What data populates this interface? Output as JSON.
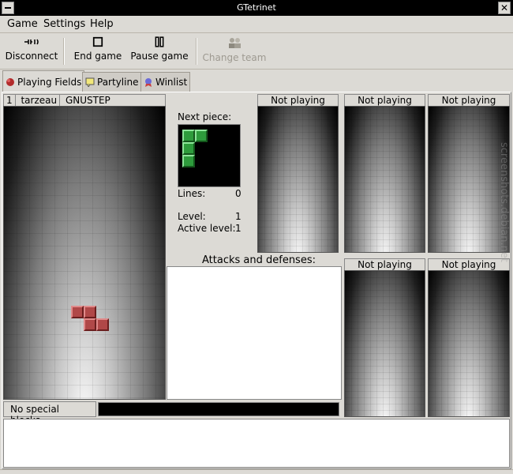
{
  "window": {
    "title": "GTetrinet"
  },
  "menu": {
    "game": "Game",
    "settings": "Settings",
    "help": "Help"
  },
  "toolbar": {
    "disconnect": "Disconnect",
    "end_game": "End game",
    "pause_game": "Pause game",
    "change_team": "Change team"
  },
  "tabs": [
    {
      "label": "Playing Fields",
      "icon": "playing-fields-icon"
    },
    {
      "label": "Partyline",
      "icon": "partyline-icon"
    },
    {
      "label": "Winlist",
      "icon": "winlist-icon"
    }
  ],
  "player": {
    "number": "1",
    "name": "tarzeau",
    "team": "GNUSTEP"
  },
  "info": {
    "next_piece_label": "Next piece:",
    "lines_label": "Lines:",
    "lines_value": "0",
    "level_label": "Level:",
    "level_value": "1",
    "active_level_label": "Active level:",
    "active_level_value": "1"
  },
  "attacks_label": "Attacks and defenses:",
  "opponents": [
    {
      "status": "Not playing"
    },
    {
      "status": "Not playing"
    },
    {
      "status": "Not playing"
    },
    {
      "status": "Not playing"
    },
    {
      "status": "Not playing"
    }
  ],
  "special_blocks": "No special blocks",
  "watermark": "screenshots.debian.net",
  "colors": {
    "piece_red": "#b04848",
    "piece_green": "#2e9b3c",
    "titlebar": "#000000"
  }
}
